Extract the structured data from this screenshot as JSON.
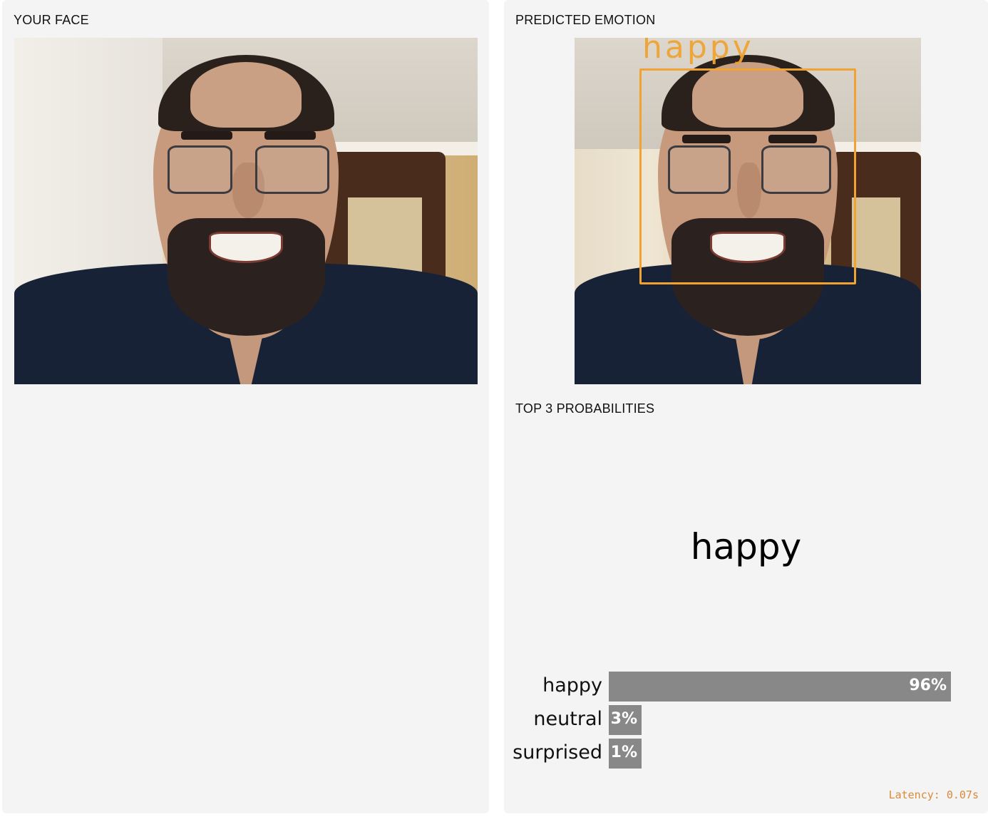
{
  "left_panel": {
    "label": "YOUR FACE",
    "image_description": "webcam-photo"
  },
  "right_panel": {
    "label": "PREDICTED EMOTION",
    "detection_label": "happy",
    "probabilities_label": "TOP 3 PROBABILITIES",
    "predicted": "happy",
    "bars": [
      {
        "name": "happy",
        "percent_text": "96%",
        "value": 0.96
      },
      {
        "name": "neutral",
        "percent_text": "3%",
        "value": 0.03
      },
      {
        "name": "surprised",
        "percent_text": "1%",
        "value": 0.01
      }
    ],
    "latency": "Latency: 0.07s"
  },
  "colors": {
    "panel_bg": "#f4f4f4",
    "detection_box": "#f0a332",
    "bar": "#888888",
    "latency": "#d98a3a"
  }
}
